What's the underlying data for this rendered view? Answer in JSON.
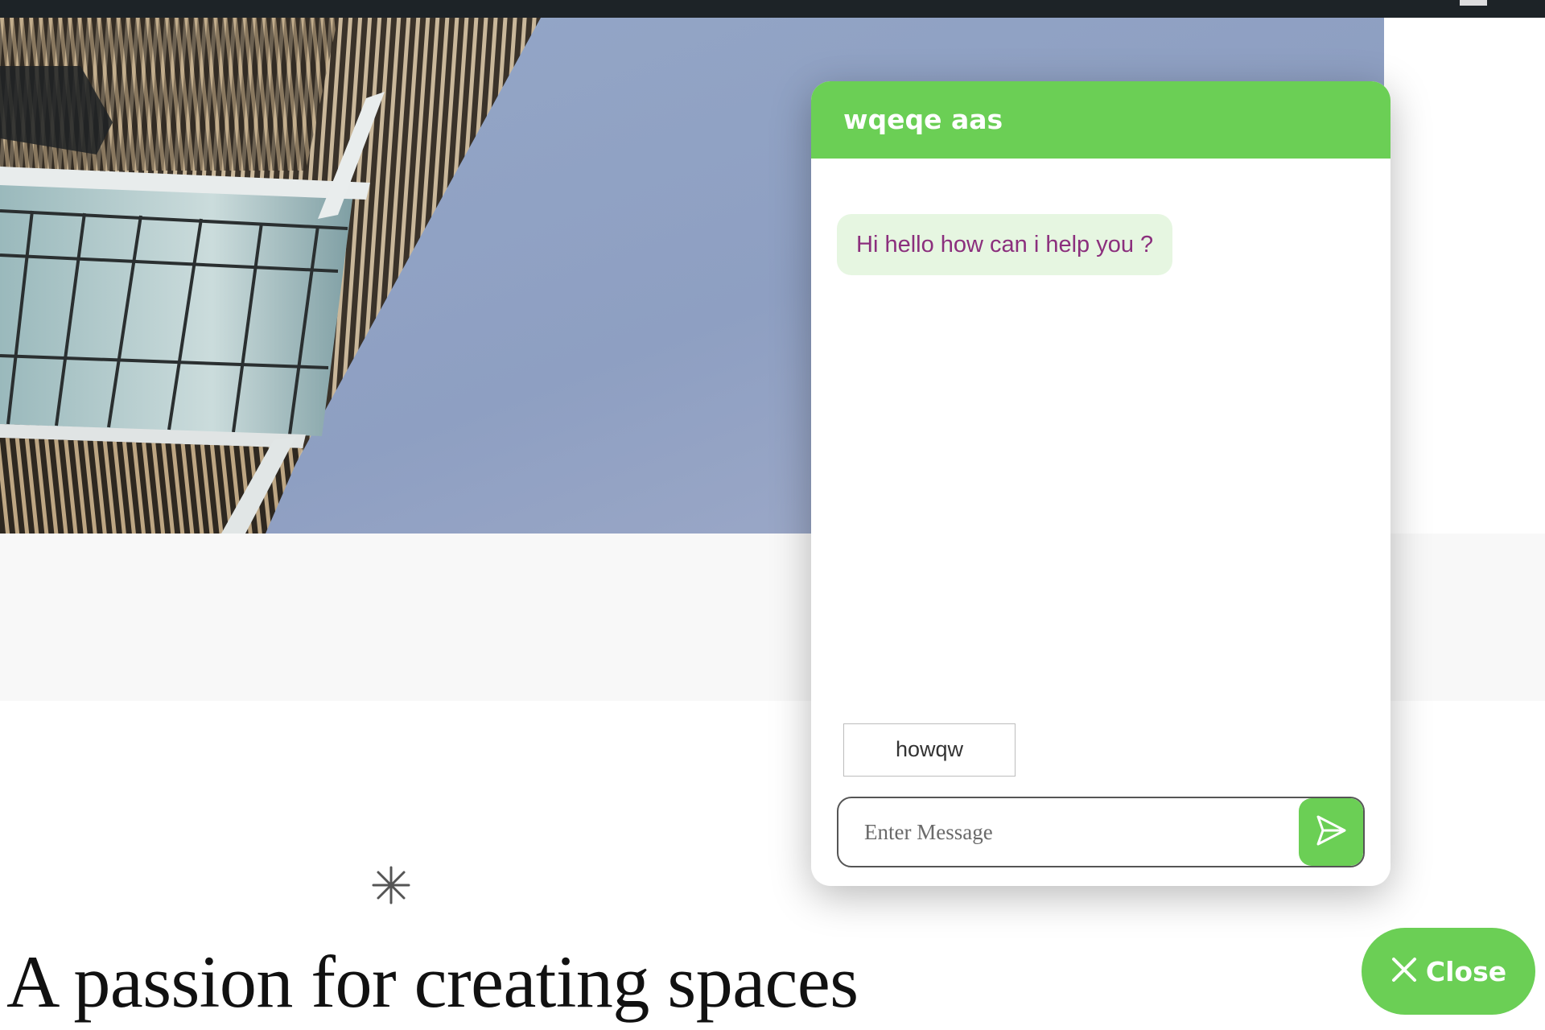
{
  "colors": {
    "accent": "#6bcf55",
    "bubble_background": "#e6f6e1",
    "bubble_text": "#8b2f7d",
    "admin_bar": "#1d2327",
    "heading_text": "#111111"
  },
  "hero": {
    "image": "building-facade-against-sky"
  },
  "page": {
    "heading": "A passion for creating spaces",
    "divider_icon": "asterisk-icon"
  },
  "chat": {
    "title": "wqeqe aas",
    "messages": [
      {
        "from": "bot",
        "text": "Hi hello how can i help you ?"
      }
    ],
    "quick_replies": [
      "howqw"
    ],
    "input": {
      "placeholder": "Enter Message",
      "value": ""
    },
    "send_icon": "send-icon"
  },
  "close_button": {
    "label": "Close",
    "icon": "close-icon"
  }
}
